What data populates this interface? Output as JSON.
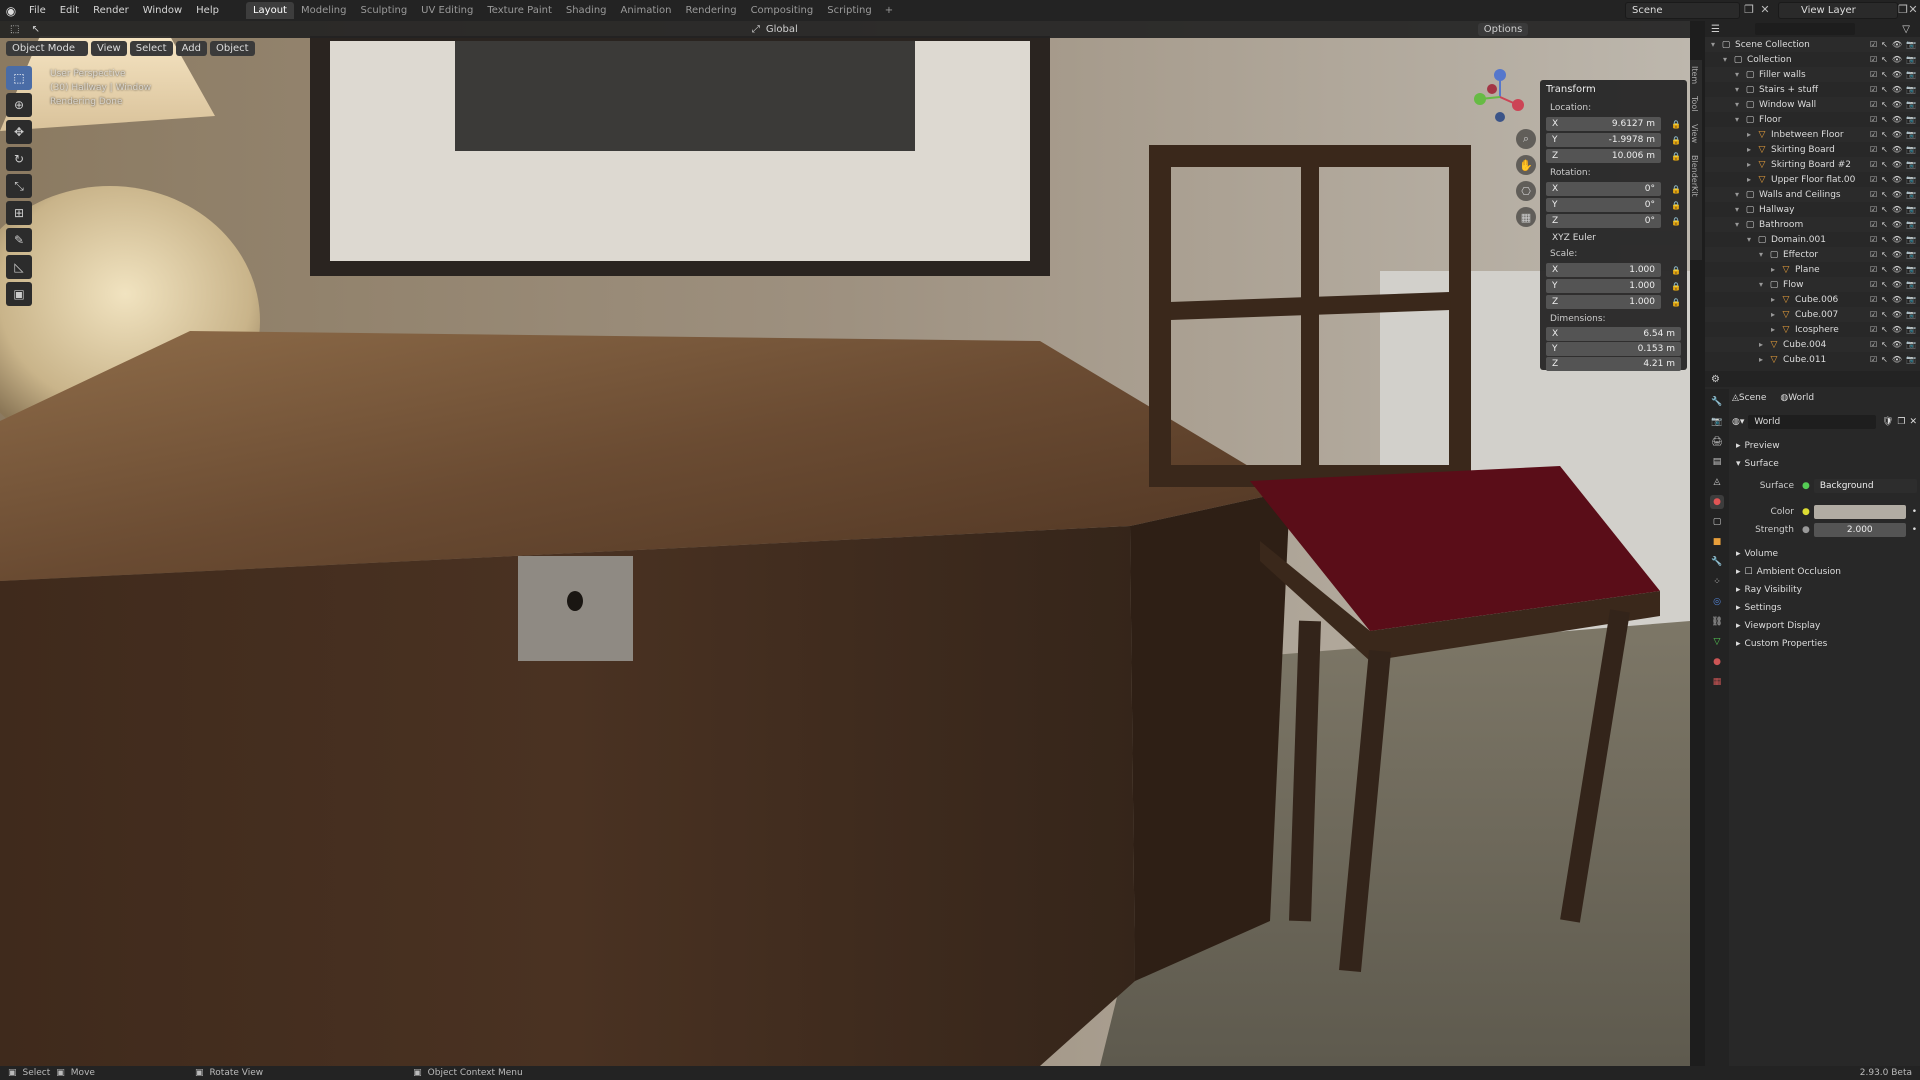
{
  "menu": [
    "File",
    "Edit",
    "Render",
    "Window",
    "Help"
  ],
  "workspaces": [
    "Layout",
    "Modeling",
    "Sculpting",
    "UV Editing",
    "Texture Paint",
    "Shading",
    "Animation",
    "Rendering",
    "Compositing",
    "Scripting"
  ],
  "active_workspace": "Layout",
  "scene": "Scene",
  "view_layer": "View Layer",
  "viewport": {
    "mode": "Object Mode",
    "menus": [
      "View",
      "Select",
      "Add",
      "Object"
    ],
    "orientation": "Global",
    "options": "Options",
    "overlay": [
      "User Perspective",
      "(30) Hallway | Window",
      "Rendering Done"
    ],
    "vtabs": [
      "Item",
      "Tool",
      "View",
      "BlenderKit"
    ]
  },
  "transform": {
    "title": "Transform",
    "location_label": "Location:",
    "location": [
      [
        "X",
        "9.6127 m"
      ],
      [
        "Y",
        "-1.9978 m"
      ],
      [
        "Z",
        "10.006 m"
      ]
    ],
    "rotation_label": "Rotation:",
    "rotation": [
      [
        "X",
        "0°"
      ],
      [
        "Y",
        "0°"
      ],
      [
        "Z",
        "0°"
      ]
    ],
    "rotation_mode": "XYZ Euler",
    "scale_label": "Scale:",
    "scale": [
      [
        "X",
        "1.000"
      ],
      [
        "Y",
        "1.000"
      ],
      [
        "Z",
        "1.000"
      ]
    ],
    "dimensions_label": "Dimensions:",
    "dimensions": [
      [
        "X",
        "6.54 m"
      ],
      [
        "Y",
        "0.153 m"
      ],
      [
        "Z",
        "4.21 m"
      ]
    ]
  },
  "outliner": {
    "rows": [
      {
        "name": "Scene Collection",
        "depth": 0,
        "type": "col"
      },
      {
        "name": "Collection",
        "depth": 1,
        "type": "col"
      },
      {
        "name": "Filler walls",
        "depth": 2,
        "type": "col"
      },
      {
        "name": "Stairs + stuff",
        "depth": 2,
        "type": "col"
      },
      {
        "name": "Window Wall",
        "depth": 2,
        "type": "col"
      },
      {
        "name": "Floor",
        "depth": 2,
        "type": "col"
      },
      {
        "name": "Inbetween Floor",
        "depth": 3,
        "type": "mesh"
      },
      {
        "name": "Skirting Board",
        "depth": 3,
        "type": "mesh"
      },
      {
        "name": "Skirting Board #2",
        "depth": 3,
        "type": "mesh"
      },
      {
        "name": "Upper Floor flat.00",
        "depth": 3,
        "type": "mesh"
      },
      {
        "name": "Walls and Ceilings",
        "depth": 2,
        "type": "col"
      },
      {
        "name": "Hallway",
        "depth": 2,
        "type": "col"
      },
      {
        "name": "Bathroom",
        "depth": 2,
        "type": "col"
      },
      {
        "name": "Domain.001",
        "depth": 3,
        "type": "col"
      },
      {
        "name": "Effector",
        "depth": 4,
        "type": "col"
      },
      {
        "name": "Plane",
        "depth": 5,
        "type": "mesh"
      },
      {
        "name": "Flow",
        "depth": 4,
        "type": "col"
      },
      {
        "name": "Cube.006",
        "depth": 5,
        "type": "mesh"
      },
      {
        "name": "Cube.007",
        "depth": 5,
        "type": "mesh"
      },
      {
        "name": "Icosphere",
        "depth": 5,
        "type": "mesh"
      },
      {
        "name": "Cube.004",
        "depth": 4,
        "type": "mesh"
      },
      {
        "name": "Cube.011",
        "depth": 4,
        "type": "mesh"
      }
    ]
  },
  "properties": {
    "breadcrumb_scene": "Scene",
    "breadcrumb_world": "World",
    "world_name": "World",
    "sections": [
      "Preview",
      "Surface"
    ],
    "surface_label": "Surface",
    "surface_value": "Background",
    "color_label": "Color",
    "strength_label": "Strength",
    "strength_value": "2.000",
    "more_sections": [
      "Volume",
      "Ambient Occlusion",
      "Ray Visibility",
      "Settings",
      "Viewport Display",
      "Custom Properties"
    ]
  },
  "status": {
    "select": "Select",
    "move": "Move",
    "rotate": "Rotate View",
    "context": "Object Context Menu",
    "version": "2.93.0 Beta"
  }
}
